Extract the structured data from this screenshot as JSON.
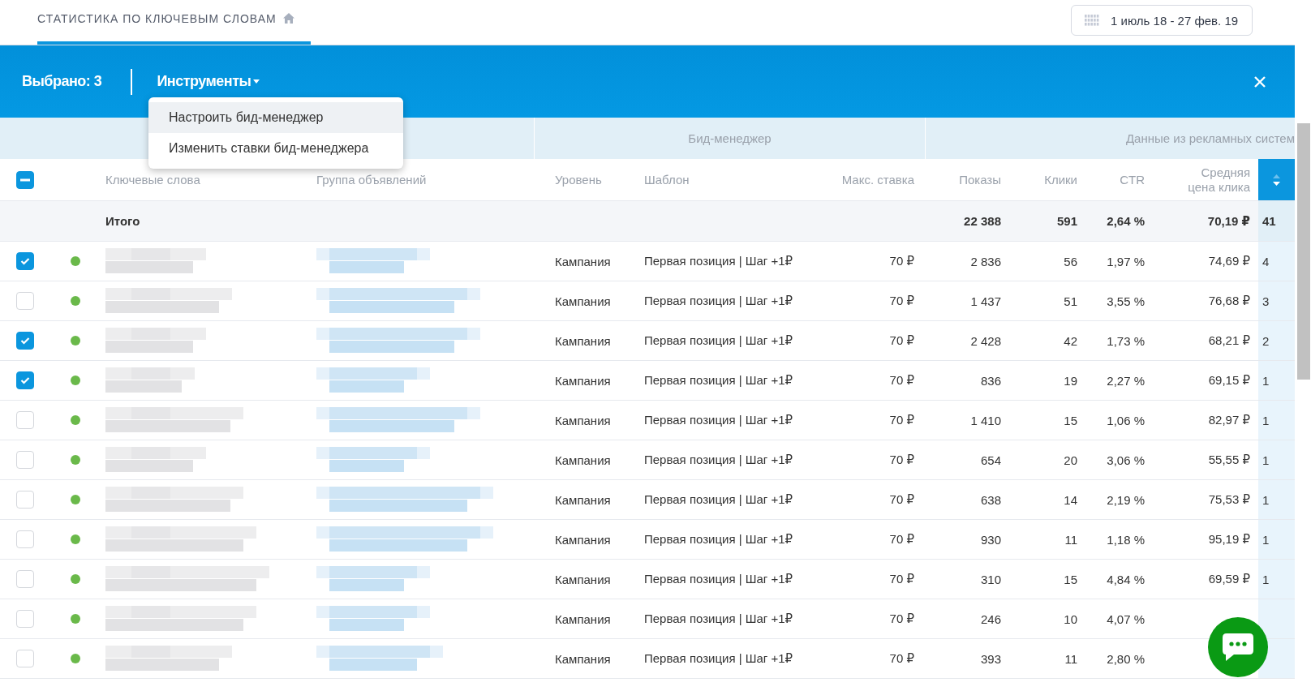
{
  "header": {
    "tab": {
      "label": "СТАТИСТИКА ПО КЛЮЧЕВЫМ СЛОВАМ",
      "selected": true
    },
    "date_range": "1 июль 18 - 27 фев. 19"
  },
  "selection_bar": {
    "selected_count": "Выбрано: 3",
    "tools_menu": "Инструменты",
    "menu_items": [
      {
        "label": "Настроить бид-менеджер",
        "highlighted": true
      },
      {
        "label": "Изменить ставки бид-менеджера",
        "highlighted": false
      }
    ]
  },
  "table": {
    "groups": [
      "Бид-менеджер",
      "Данные из рекламных систем"
    ],
    "select_all_partial": true,
    "columns": [
      "Ключевые слова",
      "Группа объявлений",
      "Уровень",
      "Шаблон",
      "Макс. ставка",
      "Показы",
      "Клики",
      "CTR",
      "Средняя цена клика"
    ],
    "totals": {
      "label": "Итого",
      "impressions": "22 388",
      "clicks": "591",
      "ctr": "2,64 %",
      "avg_cpc": "70,19 ₽",
      "column_12": "41"
    },
    "rows": [
      {
        "checked": true,
        "level": "Кампания",
        "template": "Первая позиция | Шаг +1₽",
        "max_bid": "70 ₽",
        "impressions": "2 836",
        "clicks": "56",
        "ctr": "1,97 %",
        "avg_cpc": "74,69 ₽",
        "column_12": "4"
      },
      {
        "checked": false,
        "level": "Кампания",
        "template": "Первая позиция | Шаг +1₽",
        "max_bid": "70 ₽",
        "impressions": "1 437",
        "clicks": "51",
        "ctr": "3,55 %",
        "avg_cpc": "76,68 ₽",
        "column_12": "3"
      },
      {
        "checked": true,
        "level": "Кампания",
        "template": "Первая позиция | Шаг +1₽",
        "max_bid": "70 ₽",
        "impressions": "2 428",
        "clicks": "42",
        "ctr": "1,73 %",
        "avg_cpc": "68,21 ₽",
        "column_12": "2"
      },
      {
        "checked": true,
        "level": "Кампания",
        "template": "Первая позиция | Шаг +1₽",
        "max_bid": "70 ₽",
        "impressions": "836",
        "clicks": "19",
        "ctr": "2,27 %",
        "avg_cpc": "69,15 ₽",
        "column_12": "1"
      },
      {
        "checked": false,
        "level": "Кампания",
        "template": "Первая позиция | Шаг +1₽",
        "max_bid": "70 ₽",
        "impressions": "1 410",
        "clicks": "15",
        "ctr": "1,06 %",
        "avg_cpc": "82,97 ₽",
        "column_12": "1"
      },
      {
        "checked": false,
        "level": "Кампания",
        "template": "Первая позиция | Шаг +1₽",
        "max_bid": "70 ₽",
        "impressions": "654",
        "clicks": "20",
        "ctr": "3,06 %",
        "avg_cpc": "55,55 ₽",
        "column_12": "1"
      },
      {
        "checked": false,
        "level": "Кампания",
        "template": "Первая позиция | Шаг +1₽",
        "max_bid": "70 ₽",
        "impressions": "638",
        "clicks": "14",
        "ctr": "2,19 %",
        "avg_cpc": "75,53 ₽",
        "column_12": "1"
      },
      {
        "checked": false,
        "level": "Кампания",
        "template": "Первая позиция | Шаг +1₽",
        "max_bid": "70 ₽",
        "impressions": "930",
        "clicks": "11",
        "ctr": "1,18 %",
        "avg_cpc": "95,19 ₽",
        "column_12": "1"
      },
      {
        "checked": false,
        "level": "Кампания",
        "template": "Первая позиция | Шаг +1₽",
        "max_bid": "70 ₽",
        "impressions": "310",
        "clicks": "15",
        "ctr": "4,84 %",
        "avg_cpc": "69,59 ₽",
        "column_12": "1"
      },
      {
        "checked": false,
        "level": "Кампания",
        "template": "Первая позиция | Шаг +1₽",
        "max_bid": "70 ₽",
        "impressions": "246",
        "clicks": "10",
        "ctr": "4,07 %"
      },
      {
        "checked": false,
        "level": "Кампания",
        "template": "Первая позиция | Шаг +1₽",
        "max_bid": "70 ₽",
        "impressions": "393",
        "clicks": "11",
        "ctr": "2,80 %"
      }
    ]
  }
}
